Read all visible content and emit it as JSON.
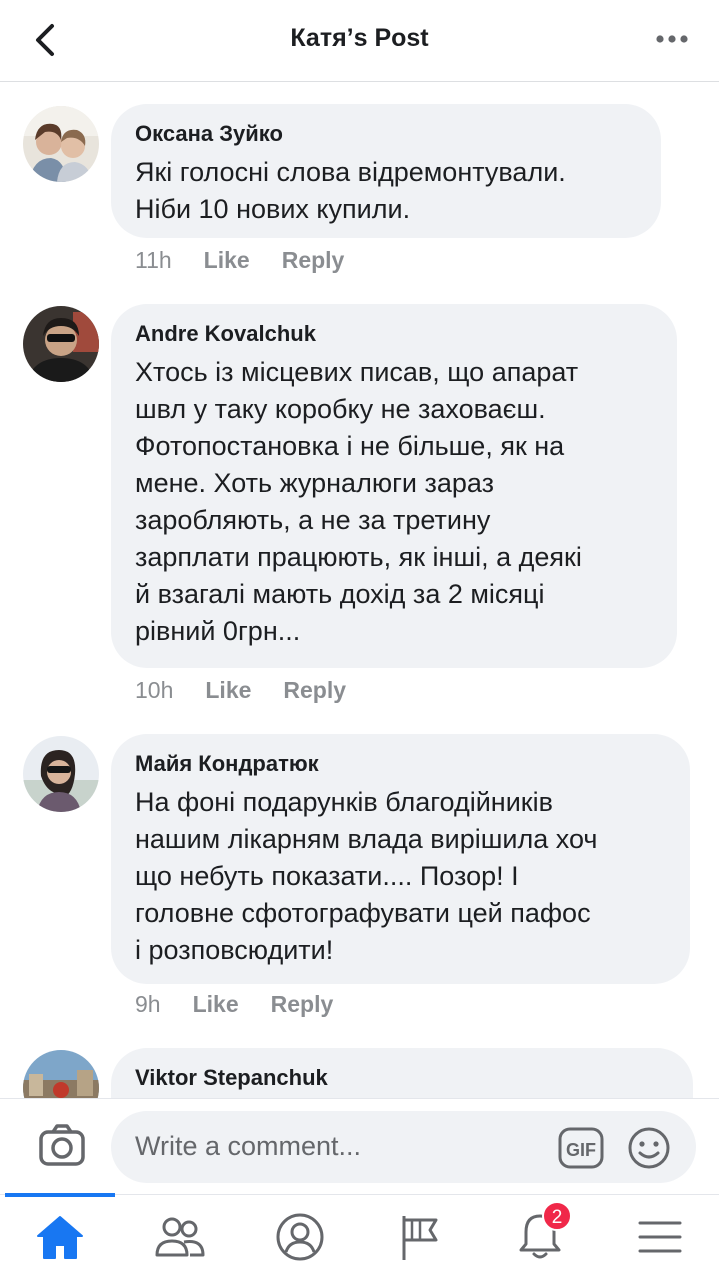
{
  "header": {
    "title": "Катя’s Post"
  },
  "comments": [
    {
      "author": "Оксана Зуйко",
      "text": "Які голосні слова відремонтували.\nНіби 10 нових купили.",
      "time": "11h",
      "like": "Like",
      "reply": "Reply"
    },
    {
      "author": "Andre Kovalchuk",
      "text": "Хтось із місцевих писав, що апарат\nшвл у таку коробку не заховаєш.\nФотопостановка і не більше, як на\nмене. Хоть журналюги зараз\nзаробляють, а не за третину\nзарплати працюють, як інші, а деякі\nй взагалі мають дохід за 2 місяці\nрівний 0грн...",
      "time": "10h",
      "like": "Like",
      "reply": "Reply"
    },
    {
      "author": "Майя Кондратюк",
      "text": "На фоні подарунків благодійників\nнашим лікарням влада вирішила хоч\nщо небуть показати.... Позор! І\nголовне сфотографувати цей пафос\nі розповсюдити!",
      "time": "9h",
      "like": "Like",
      "reply": "Reply"
    },
    {
      "author": "Viktor Stepanchuk"
    }
  ],
  "composer": {
    "placeholder": "Write a comment...",
    "gif_label": "GIF"
  },
  "tabbar": {
    "active": "home",
    "notifications_badge": "2",
    "accent": "#1877f2"
  }
}
